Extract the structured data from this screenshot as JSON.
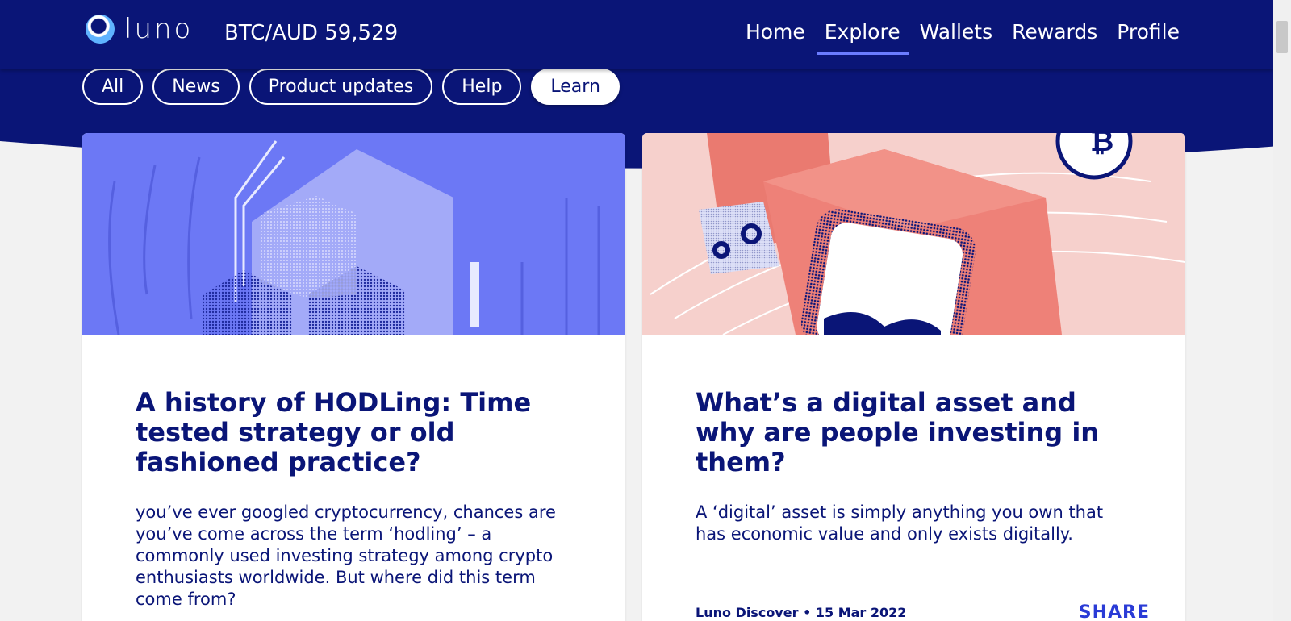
{
  "header": {
    "logo_text": "luno",
    "price_ticker": "BTC/AUD 59,529",
    "nav": [
      {
        "label": "Home"
      },
      {
        "label": "Explore",
        "active": true
      },
      {
        "label": "Wallets"
      },
      {
        "label": "Rewards"
      },
      {
        "label": "Profile"
      }
    ]
  },
  "filters": [
    {
      "label": "All"
    },
    {
      "label": "News"
    },
    {
      "label": "Product updates"
    },
    {
      "label": "Help"
    },
    {
      "label": "Learn",
      "selected": true
    }
  ],
  "cards": [
    {
      "title": "A history of HODLing: Time tested strategy or old fashioned practice?",
      "description": "you’ve ever googled cryptocurrency, chances are you’ve come across the term ‘hodling’ – a commonly used investing strategy among crypto enthusiasts worldwide. But where did this term come from?",
      "image_icon": "hodl-cubes-illustration"
    },
    {
      "title": "What’s a digital asset and why are people investing in them?",
      "description": "A ‘digital’ asset is simply anything you own that has economic value and only exists digitally.",
      "author": "Luno Discover",
      "date": "15 Mar 2022",
      "share_label": "SHARE",
      "image_icon": "digital-asset-illustration"
    }
  ],
  "colors": {
    "brand_navy": "#0a1577",
    "accent_blue": "#2a3bd6",
    "active_underline": "#6b7cff",
    "card1_bg": "#6c78f5",
    "card2_bg": "#f6d0cc"
  }
}
